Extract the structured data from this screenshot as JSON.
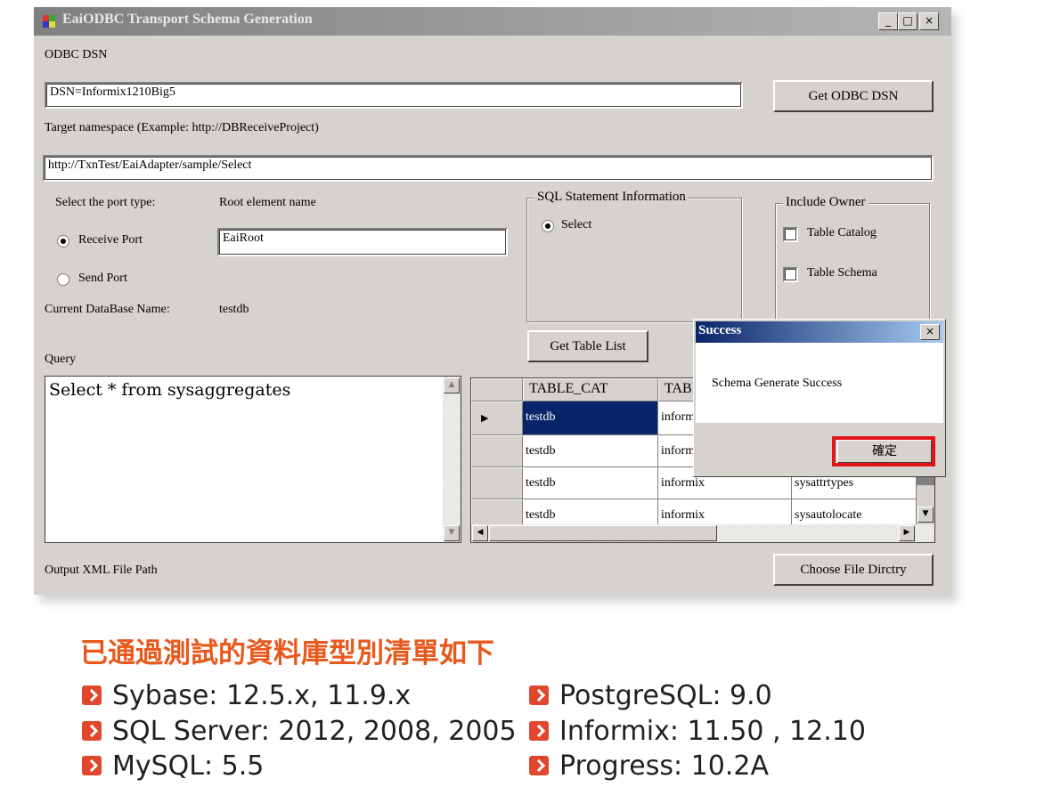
{
  "window": {
    "title": "EaiODBC Transport Schema Generation",
    "controls": [
      "_",
      "□",
      "×"
    ]
  },
  "form": {
    "odbc_dsn_label": "ODBC DSN",
    "dsn_value": "DSN=Informix1210Big5",
    "get_dsn_button": "Get ODBC DSN",
    "namespace_label": "Target namespace (Example: http://DBReceiveProject)",
    "namespace_value": "http://TxnTest/EaiAdapter/sample/Select",
    "port_type_label": "Select the port type:",
    "root_element_label": "Root element name",
    "root_element_value": "EaiRoot",
    "receive_port": "Receive Port",
    "send_port": "Send Port",
    "db_name_label": "Current DataBase Name:",
    "db_name_value": "testdb",
    "sql_group_caption": "SQL Statement Information",
    "sql_select": "Select",
    "owner_group_caption": "Include Owner",
    "table_catalog": "Table Catalog",
    "table_schema": "Table Schema",
    "get_table_list_button": "Get Table List",
    "query_label": "Query",
    "query_value": "Select * from sysaggregates",
    "output_path_label": "Output XML File Path",
    "choose_dir_button": "Choose File Dirctry"
  },
  "grid": {
    "columns": [
      "TABLE_CAT",
      "TABLE_S"
    ],
    "rows": [
      [
        "testdb",
        "informix",
        ""
      ],
      [
        "testdb",
        "informix",
        ""
      ],
      [
        "testdb",
        "informix",
        "sysattrtypes"
      ],
      [
        "testdb",
        "informix",
        "sysautolocate"
      ]
    ]
  },
  "dialog": {
    "title": "Success",
    "message": "Schema Generate Success",
    "ok_button": "確定"
  },
  "caption": {
    "heading": "已通過測試的資料庫型別清單如下",
    "items": [
      "Sybase: 12.5.x, 11.9.x",
      "SQL Server: 2012, 2008, 2005",
      "MySQL: 5.5",
      "PostgreSQL: 9.0",
      "Informix: 11.50 , 12.10",
      "Progress: 10.2A"
    ]
  },
  "colors": {
    "heading": "#e7591c",
    "bullet": "#e1472d",
    "highlight": "#e3141b",
    "selected_cell": "#0a246a"
  }
}
